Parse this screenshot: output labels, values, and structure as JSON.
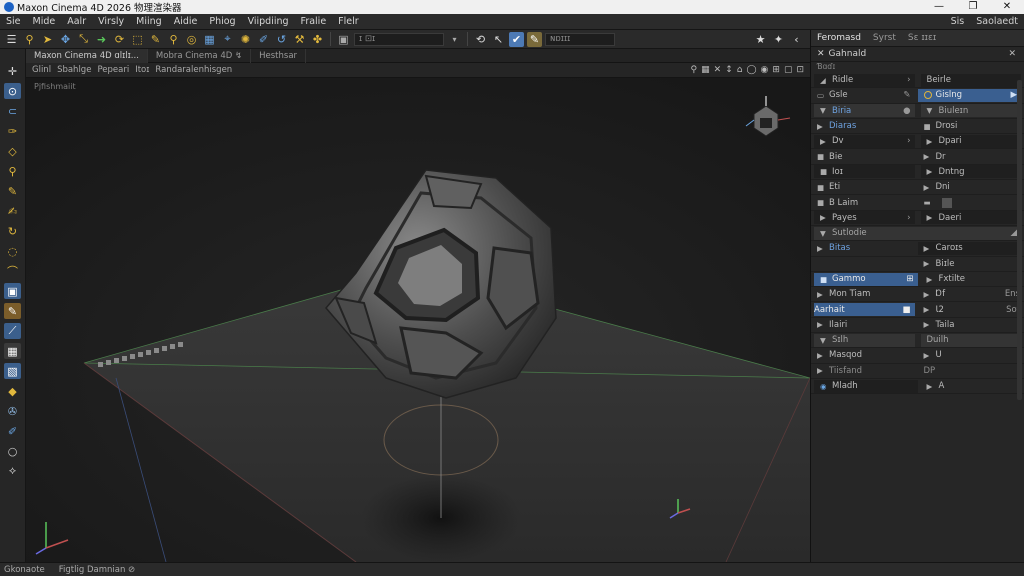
{
  "window": {
    "title": "Maxon Cinema 4D 2026 物理渲染器",
    "minimize": "—",
    "maximize": "❐",
    "close": "✕"
  },
  "menubar": {
    "items": [
      "Sie",
      "Mide",
      "Aalr",
      "Virsly",
      "Miing",
      "Aidie",
      "Phiog",
      "Viipdiing",
      "Fralie",
      "Flelr"
    ],
    "right": [
      "Sis",
      "Saolaedt"
    ]
  },
  "toolbar": {
    "field1": "ɪ ⊡ɪ",
    "field2": "ɴɒɪɪɪ",
    "icons": [
      "search-icon",
      "cursor-icon",
      "move-icon",
      "scale-icon",
      "arrow-icon",
      "rotate-icon",
      "select-icon",
      "pen-icon",
      "zoom-icon",
      "target-icon",
      "grid-icon",
      "render-icon",
      "star-icon",
      "pin-icon"
    ]
  },
  "viewport_tabs": {
    "tabs": [
      "Maxon Cinema 4D ɑlɪlɪ...",
      "Mobra Cinema 4D ↯",
      "Hesthsar"
    ],
    "active": 0
  },
  "viewport_menu": {
    "items": [
      "Glinl",
      "Sbahlge",
      "Pepeari",
      "Itoɪ",
      "Randaralenhisgen"
    ]
  },
  "viewport": {
    "label": "Pjfishmaiit"
  },
  "right_panel": {
    "tabs": [
      "Feromasd",
      "Syrst",
      "Sɛ ɪɪɛɪ"
    ],
    "active_tab": 0,
    "header": "Gahnald",
    "sub": "Ɓɑɗɪ",
    "rows": [
      [
        "Ridle",
        "Beirle"
      ],
      [
        "Gsle",
        "Gislng"
      ],
      [
        "Biria",
        "Biuleɪn"
      ],
      [
        "Diaras",
        "Drosi"
      ],
      [
        "Dv",
        "Dpari"
      ],
      [
        "Bie",
        "Dr"
      ],
      [
        "Ioɪ",
        "Dntng"
      ],
      [
        "Eti",
        "Dni"
      ],
      [
        "B Laim",
        ""
      ],
      [
        "Payes",
        "Daeri"
      ],
      [
        "Sutlodie",
        ""
      ],
      [
        "Bitas",
        "Caroɪs"
      ],
      [
        "",
        "Biɪle"
      ],
      [
        "Gammo",
        "Fxtilte"
      ],
      [
        "Mon Tiam",
        "Ɒf",
        "Ens"
      ],
      [
        "Aarhait",
        "Ɩ2",
        "Sot"
      ],
      [
        "Ilairi",
        "Taila"
      ],
      [
        "Sɪlh",
        "Duilh"
      ],
      [
        "Masqod",
        "U"
      ],
      [
        "Tiisfand",
        "DP"
      ],
      [
        "Mladh",
        "A"
      ]
    ]
  },
  "statusbar": {
    "left": "Gkonaote",
    "right": "Fiɡtlig Damnian ⊘"
  }
}
